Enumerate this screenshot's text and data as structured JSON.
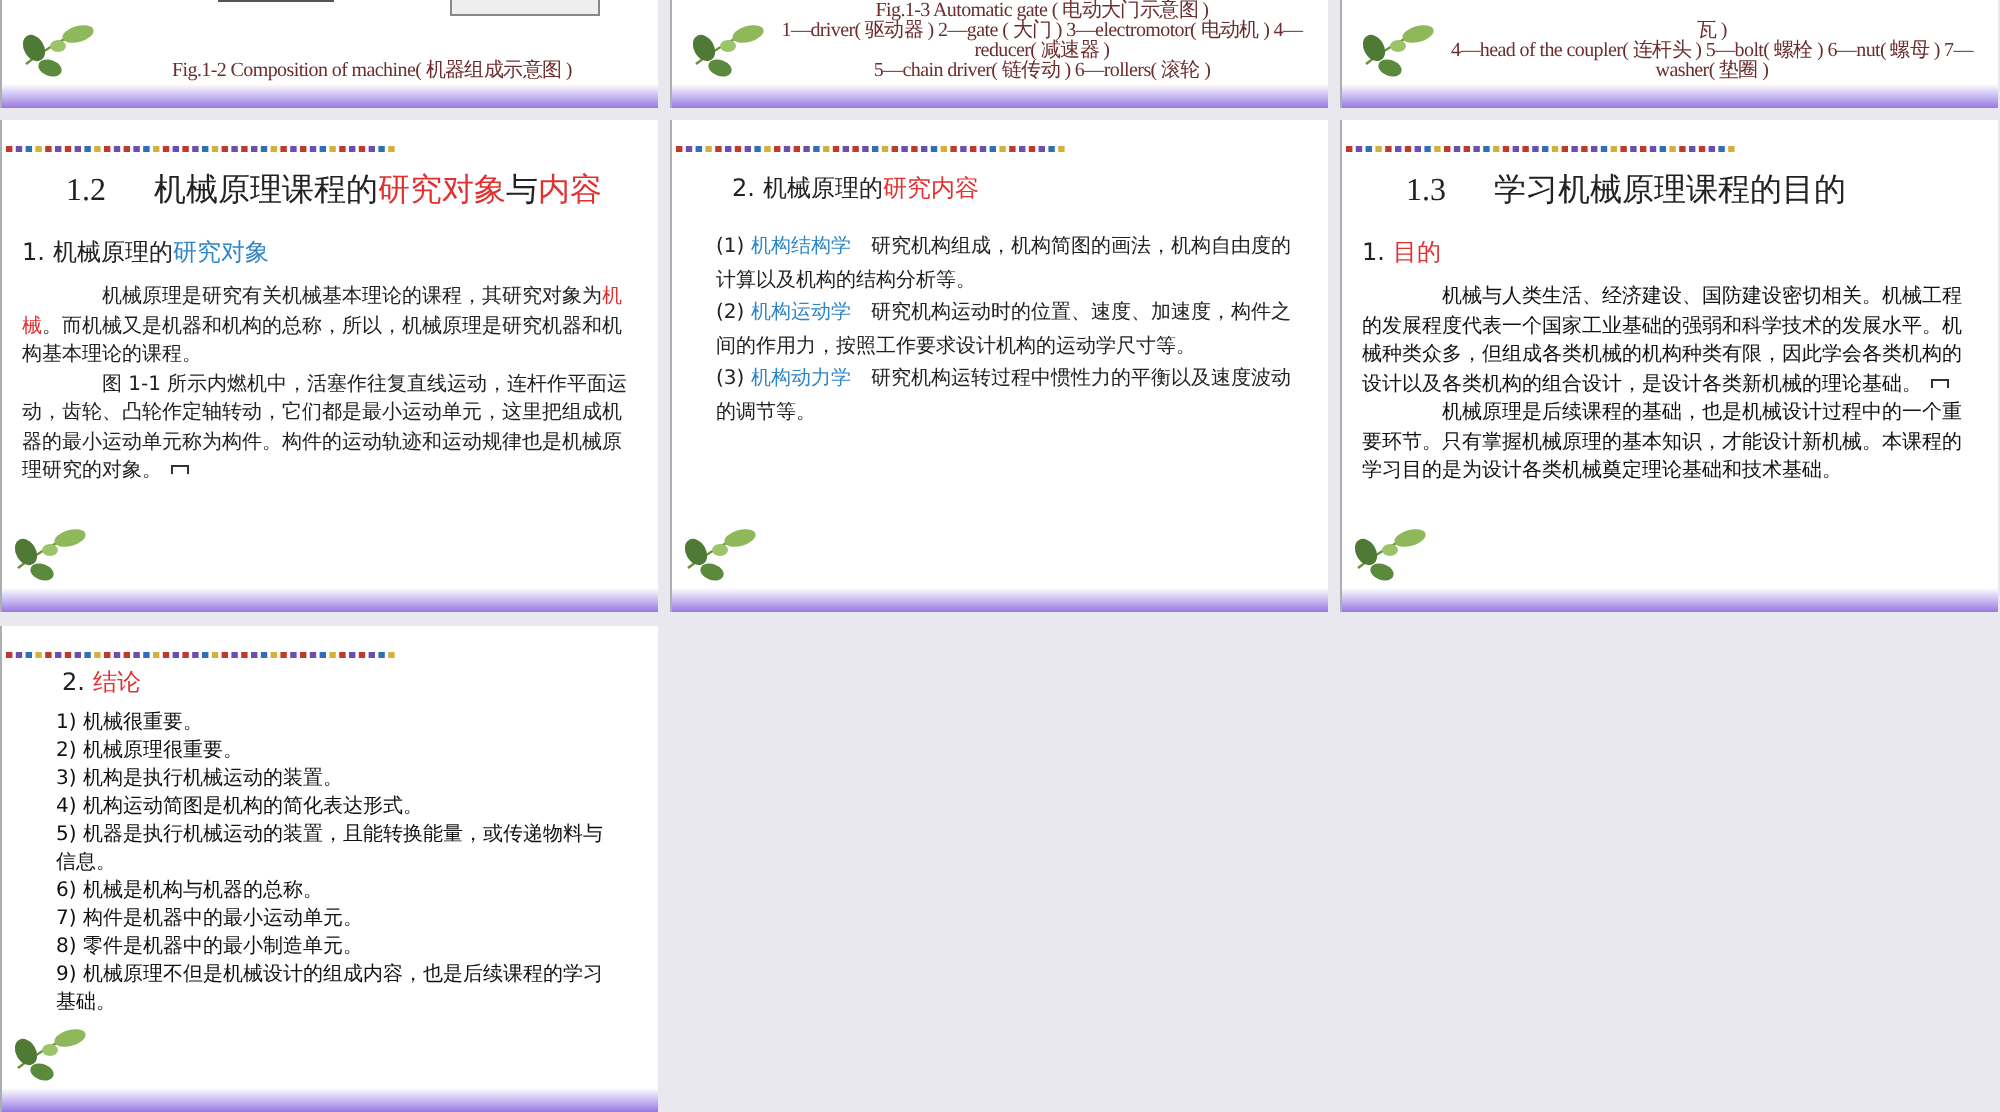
{
  "top_slides": [
    {
      "diagram_boxes": true,
      "caption_lines": [
        "Fig.1-2      Composition of machine( 机器组成示意图 )"
      ]
    },
    {
      "diagram_boxes": false,
      "caption_lines": [
        "Fig.1-3      Automatic gate ( 电动大门示意图 )",
        "1—driver( 驱动器 )   2—gate ( 大门 )   3—electromotor( 电动机 )   4—",
        "reducer( 减速器 )",
        "5—chain driver( 链传动 )   6—rollers( 滚轮 )"
      ]
    },
    {
      "diagram_boxes": false,
      "caption_lines": [
        "瓦 )",
        "4—head of the coupler( 连杆头 )   5—bolt( 螺栓 )   6—nut( 螺母 )   7—",
        "washer( 垫圈 )"
      ]
    }
  ],
  "slides": [
    {
      "kind": "section",
      "number": "1.2",
      "title": [
        {
          "text": "机械原理课程的",
          "color": "#222222"
        },
        {
          "text": "研究对象",
          "color": "#e0302f"
        },
        {
          "text": "与",
          "color": "#222222"
        },
        {
          "text": "内容",
          "color": "#e0302f"
        }
      ],
      "subtitle": [
        {
          "text": "1. 机械原理的",
          "color": "#222222"
        },
        {
          "text": "研究对象",
          "color": "#2e86c8"
        }
      ],
      "body": [
        {
          "indent": true,
          "return_mark": false,
          "segments": [
            {
              "text": "机械原理是研究有关机械基本理论的课程，其研究对象为",
              "color": "#222222"
            },
            {
              "text": "机械",
              "color": "#e0302f"
            },
            {
              "text": "。而机械又是机器和机构的总称，所以，机械原理是研究机器和机构基本理论的课程。",
              "color": "#222222"
            }
          ]
        },
        {
          "indent": true,
          "return_mark": true,
          "segments": [
            {
              "text": "图 1-1 所示内燃机中，活塞作往复直线运动，连杆作平面运动，齿轮、凸轮作定轴转动，它们都是最小运动单元，这里把组成机器的最小运动单元称为构件。构件的运动轨迹和运动规律也是机械原理研究的对象。",
              "color": "#222222"
            }
          ]
        }
      ]
    },
    {
      "kind": "subsection",
      "subtitle": [
        {
          "text": "2. 机械原理的",
          "color": "#222222"
        },
        {
          "text": "研究内容",
          "color": "#e0302f"
        }
      ],
      "body": [
        {
          "indent": false,
          "return_mark": false,
          "segments": [
            {
              "text": "(1) ",
              "color": "#222222"
            },
            {
              "text": "机构结构学",
              "color": "#2e86c8"
            },
            {
              "text": "　研究机构组成，机构简图的画法，机构自由度的计算以及机构的结构分析等。",
              "color": "#222222"
            }
          ]
        },
        {
          "indent": false,
          "return_mark": false,
          "segments": [
            {
              "text": "(2) ",
              "color": "#222222"
            },
            {
              "text": "机构运动学",
              "color": "#2e86c8"
            },
            {
              "text": "　研究机构运动时的位置、速度、加速度，构件之间的作用力，按照工作要求设计机构的运动学尺寸等。",
              "color": "#222222"
            }
          ]
        },
        {
          "indent": false,
          "return_mark": false,
          "segments": [
            {
              "text": "(3) ",
              "color": "#222222"
            },
            {
              "text": "机构动力学",
              "color": "#2e86c8"
            },
            {
              "text": "　研究机构运转过程中惯性力的平衡以及速度波动的调节等。",
              "color": "#222222"
            }
          ]
        }
      ]
    },
    {
      "kind": "section",
      "number": "1.3",
      "title": [
        {
          "text": "学习机械原理课程的目的",
          "color": "#222222"
        }
      ],
      "subtitle": [
        {
          "text": "1. ",
          "color": "#222222"
        },
        {
          "text": "目的",
          "color": "#e0302f"
        }
      ],
      "body": [
        {
          "indent": true,
          "return_mark": true,
          "segments": [
            {
              "text": "机械与人类生活、经济建设、国防建设密切相关。机械工程的发展程度代表一个国家工业基础的强弱和科学技术的发展水平。机械种类众多，但组成各类机械的机构种类有限，因此学会各类机构的设计以及各类机构的组合设计，是设计各类新机械的理论基础。",
              "color": "#111111"
            }
          ]
        },
        {
          "indent": true,
          "return_mark": false,
          "segments": [
            {
              "text": "机械原理是后续课程的基础，也是机械设计过程中的一个重要环节。只有掌握机械原理的基本知识，才能设计新机械。本课程的学习目的是为设计各类机械奠定理论基础和技术基础。",
              "color": "#111111"
            }
          ]
        }
      ]
    },
    {
      "kind": "list",
      "subtitle": [
        {
          "text": "2. ",
          "color": "#222222"
        },
        {
          "text": "结论",
          "color": "#e0302f"
        }
      ],
      "items": [
        "1) 机械很重要。",
        "2) 机械原理很重要。",
        "3) 机构是执行机械运动的装置。",
        "4) 机构运动简图是机构的简化表达形式。",
        "5) 机器是执行机械运动的装置，且能转换能量，或传递物料与信息。",
        "6) 机械是机构与机器的总称。",
        "7) 构件是机器中的最小运动单元。",
        "8) 零件是机器中的最小制造单元。",
        "9) 机械原理不但是机械设计的组成内容，也是后续课程的学习基础。"
      ]
    }
  ]
}
